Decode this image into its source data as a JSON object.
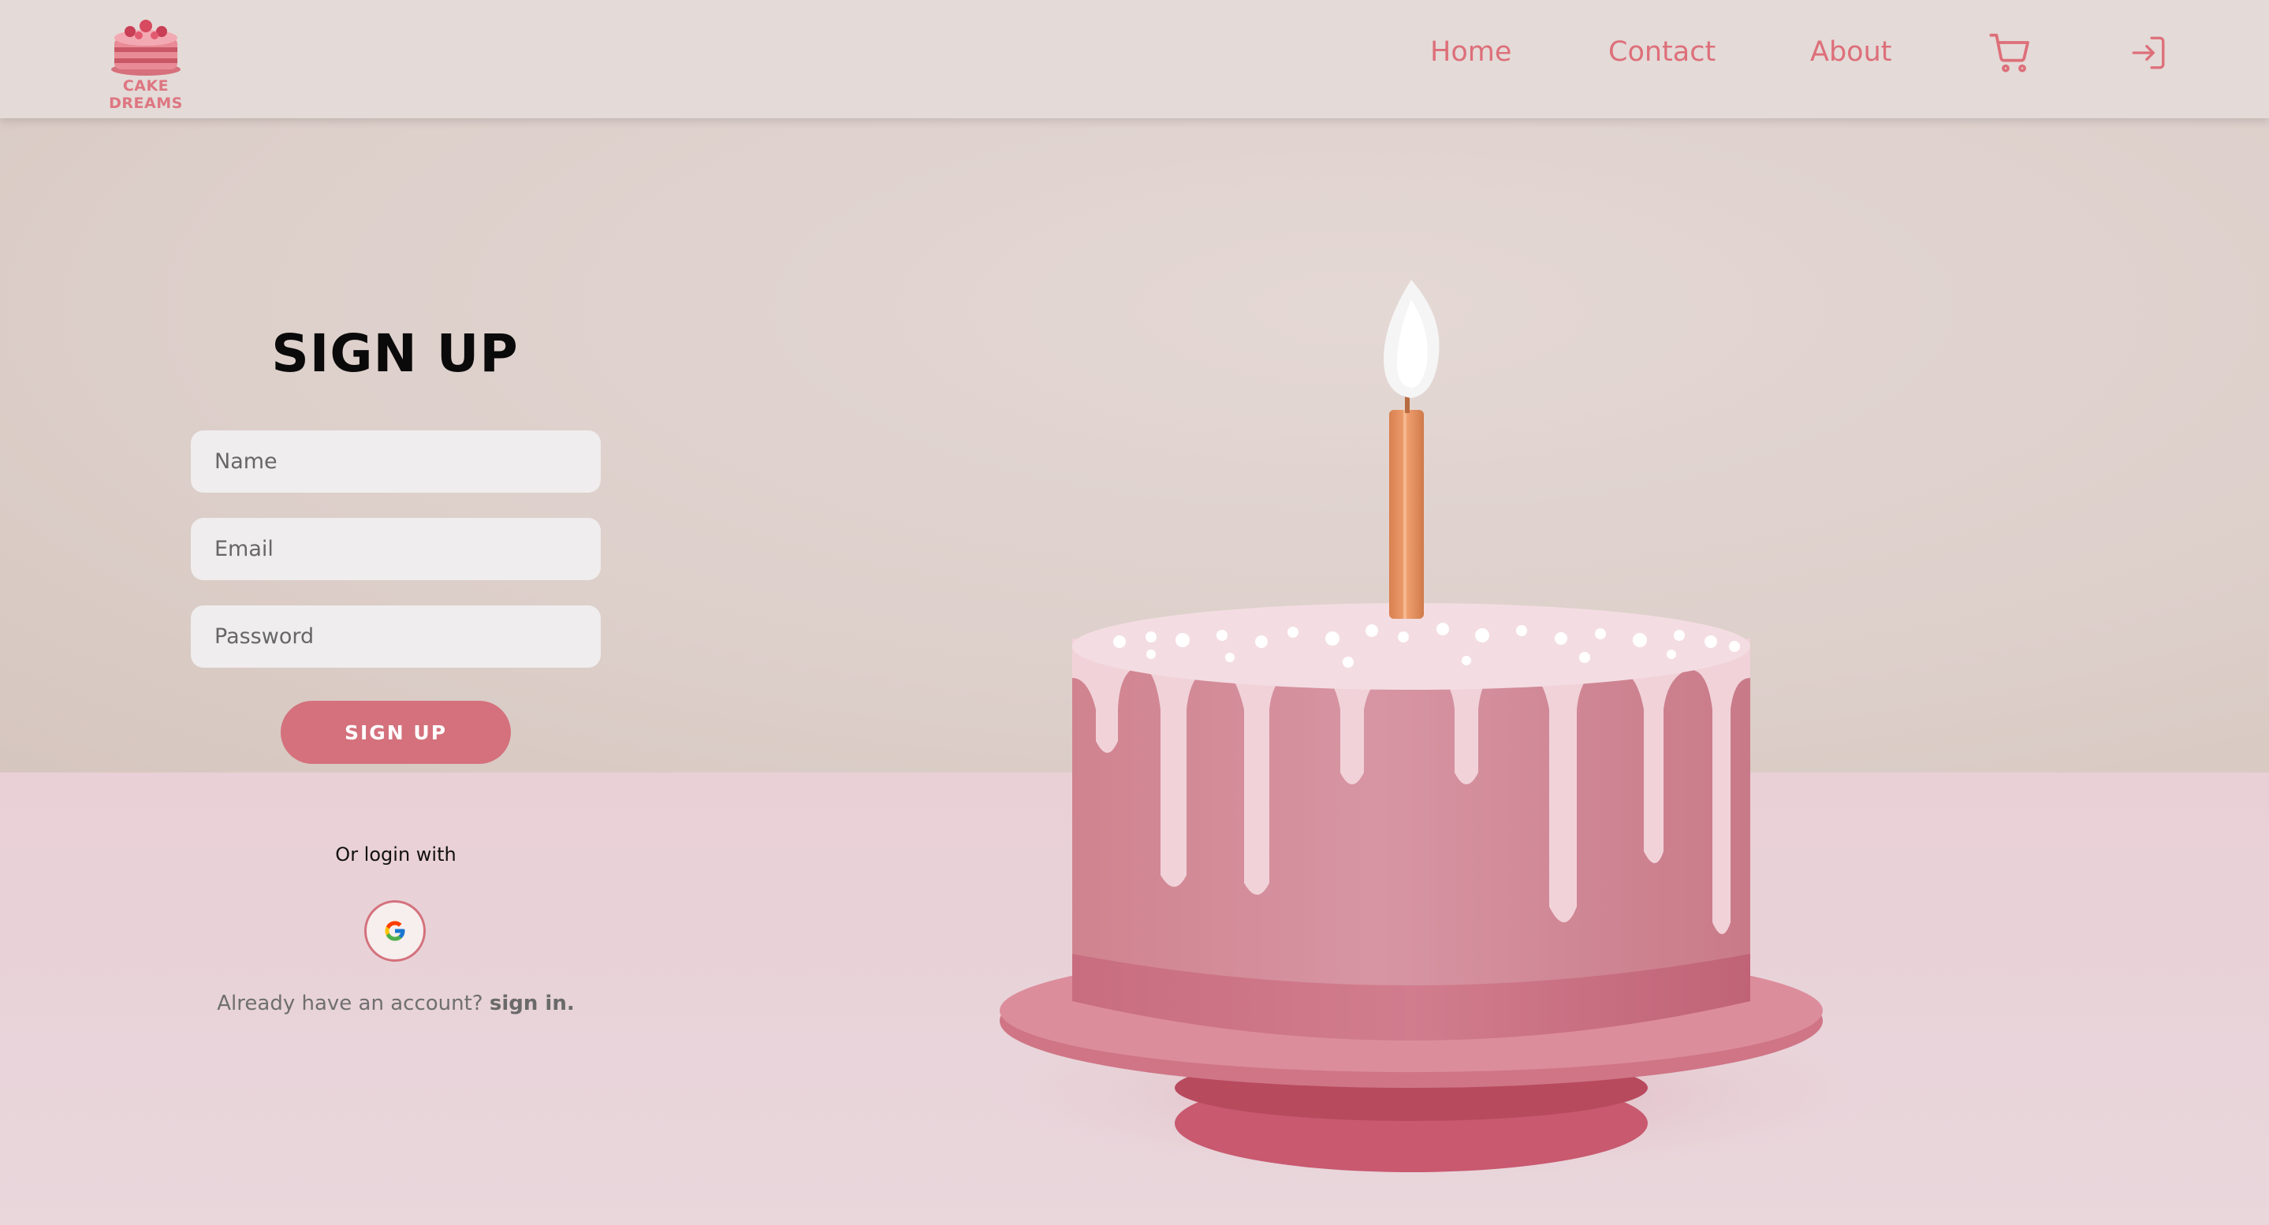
{
  "brand": {
    "name": "CAKE DREAMS",
    "accent_color": "#dd6f79"
  },
  "nav": {
    "links": [
      {
        "label": "Home"
      },
      {
        "label": "Contact"
      },
      {
        "label": "About"
      }
    ],
    "icons": [
      "cart-icon",
      "login-icon"
    ]
  },
  "form": {
    "title": "SIGN UP",
    "fields": {
      "name": {
        "placeholder": "Name",
        "value": ""
      },
      "email": {
        "placeholder": "Email",
        "value": ""
      },
      "password": {
        "placeholder": "Password",
        "value": ""
      }
    },
    "submit_label": "SIGN UP",
    "submit_color": "#d4717c",
    "alt_login_text": "Or login with",
    "alt_login_icon": "google-icon",
    "already_text": "Already have an account?",
    "signin_link": "sign in."
  }
}
